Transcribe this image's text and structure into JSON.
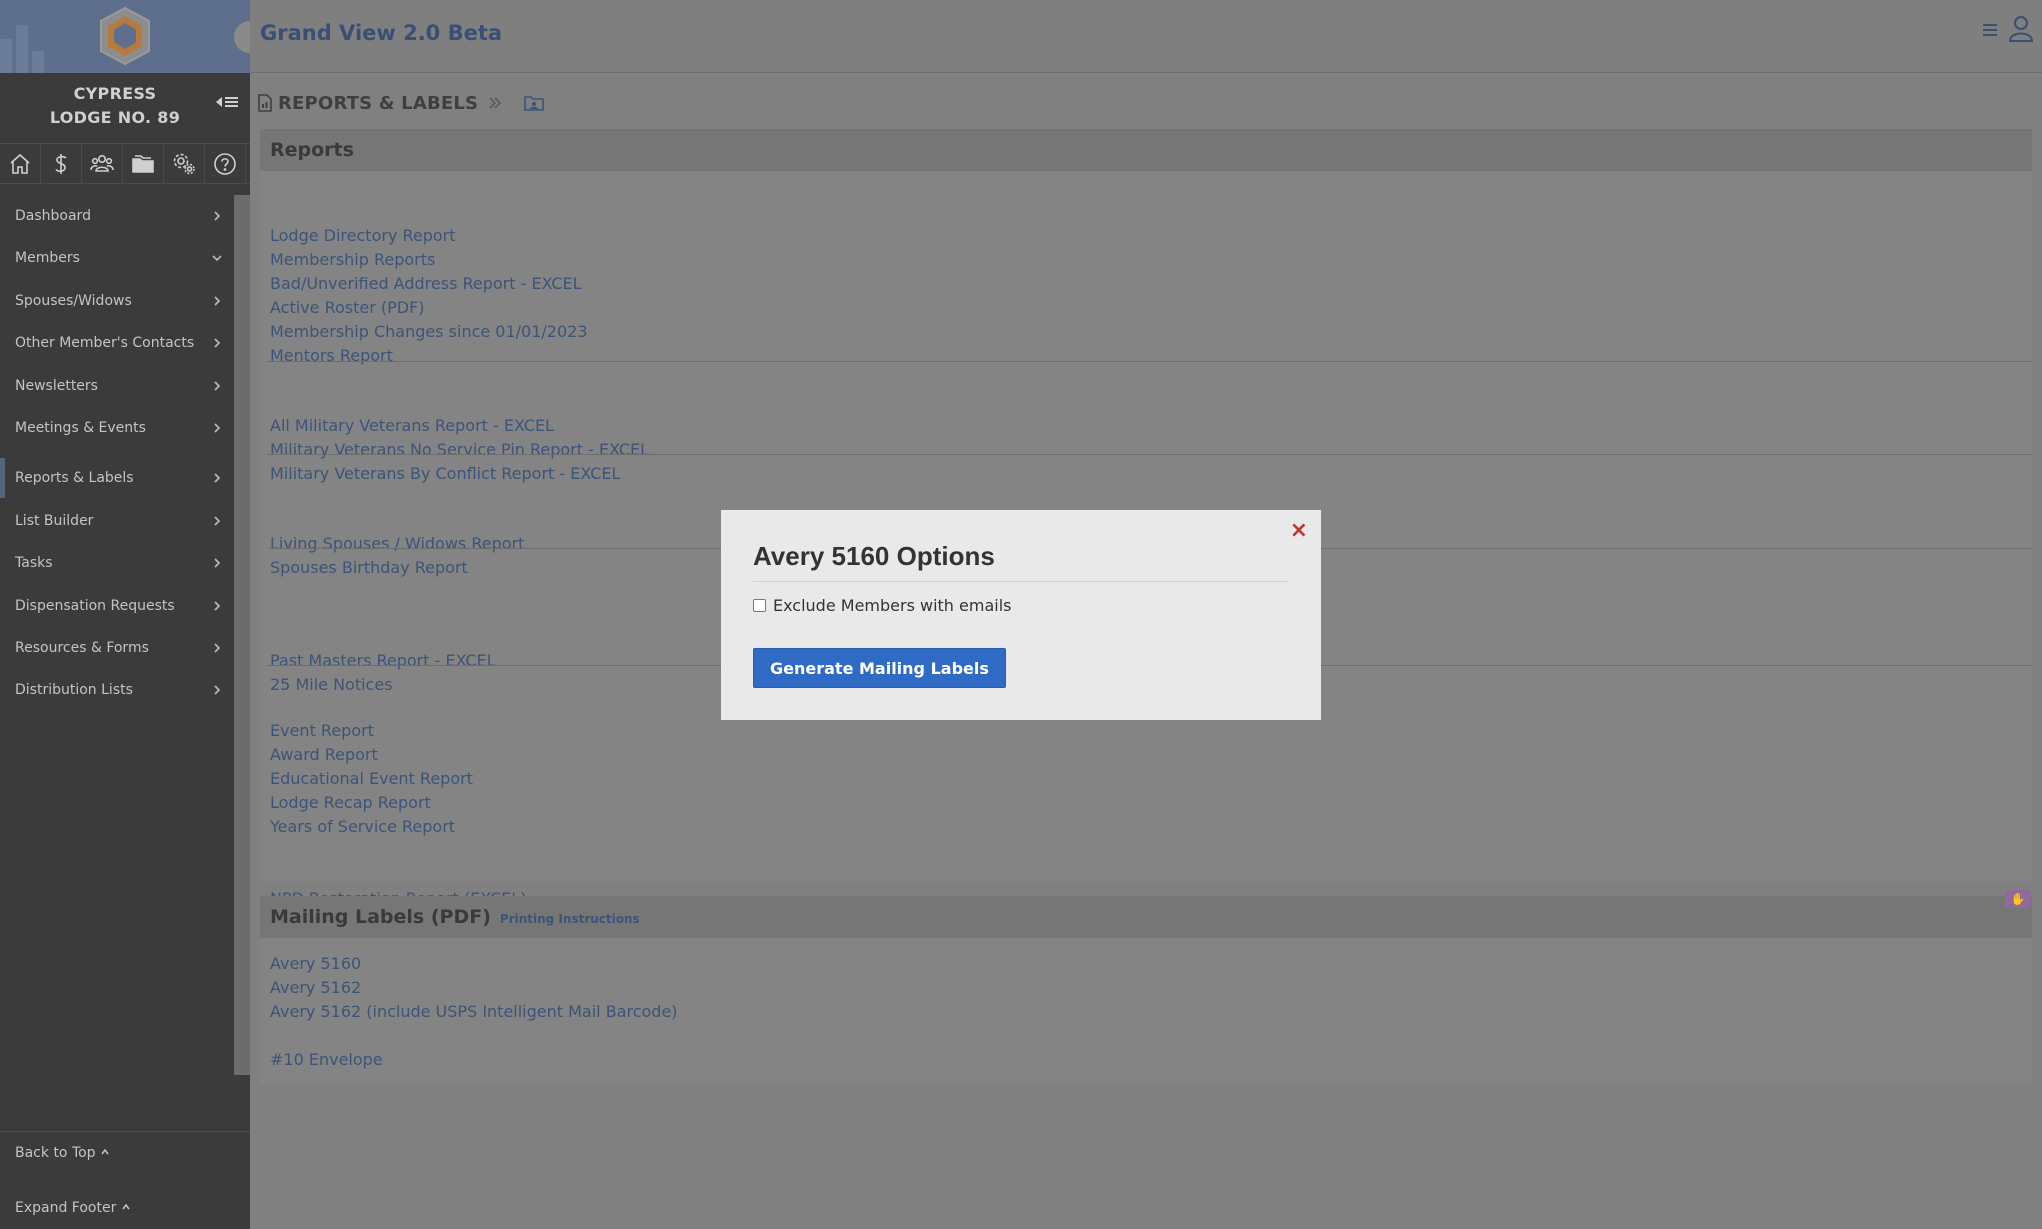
{
  "app": {
    "title": "Grand View 2.0 Beta"
  },
  "sidebar": {
    "lodge_line1": "CYPRESS",
    "lodge_line2": "LODGE NO. 89",
    "icon_bar": [
      "home-icon",
      "dollar-icon",
      "members-icon",
      "folders-icon",
      "settings-icon",
      "help-icon"
    ],
    "items": [
      {
        "label": "Dashboard"
      },
      {
        "label": "Members"
      },
      {
        "label": "Spouses/Widows"
      },
      {
        "label": "Other Member's Contacts"
      },
      {
        "label": "Newsletters"
      },
      {
        "label": "Meetings & Events"
      },
      {
        "label": "Reports & Labels"
      },
      {
        "label": "List Builder"
      },
      {
        "label": "Tasks"
      },
      {
        "label": "Dispensation Requests"
      },
      {
        "label": "Resources & Forms"
      },
      {
        "label": "Distribution Lists"
      }
    ],
    "active_item": "Reports & Labels",
    "expanded_item": "Members",
    "back_to_top": "Back to Top",
    "expand_footer": "Expand Footer"
  },
  "breadcrumb": {
    "title": "REPORTS & LABELS"
  },
  "reports": {
    "title": "Reports",
    "group1": [
      "Lodge Directory Report",
      "Membership Reports",
      "Bad/Unverified Address Report - EXCEL",
      "Active Roster (PDF)",
      "Membership Changes since 01/01/2023",
      "Mentors Report"
    ],
    "group2": [
      "All Military Veterans Report - EXCEL",
      "Military Veterans No Service Pin Report - EXCEL",
      "Military Veterans By Conflict Report - EXCEL"
    ],
    "group3": [
      "Living Spouses / Widows Report",
      "Spouses Birthday Report"
    ],
    "group4": [
      "Past Masters Report - EXCEL",
      "25 Mile Notices"
    ],
    "group5": [
      "Event Report",
      "Award Report",
      "Educational Event Report",
      "Lodge Recap Report",
      "Years of Service Report"
    ],
    "group6": [
      "NPD Restoration Report (EXCEL)"
    ]
  },
  "mailing": {
    "title": "Mailing Labels (PDF)",
    "printing_instructions": "Printing Instructions",
    "items": [
      "Avery 5160",
      "Avery 5162",
      "Avery 5162 (include USPS Intelligent Mail Barcode)"
    ],
    "envelope": "#10 Envelope"
  },
  "modal": {
    "title": "Avery 5160 Options",
    "close": "×",
    "checkbox_label": "Exclude Members with emails",
    "checkbox_checked": false,
    "button": "Generate Mailing Labels"
  },
  "colors": {
    "link": "#3c5478",
    "primary_button": "#2f6bc4",
    "close_x": "#c0352b",
    "sidebar_bg": "#3b3b3b"
  }
}
